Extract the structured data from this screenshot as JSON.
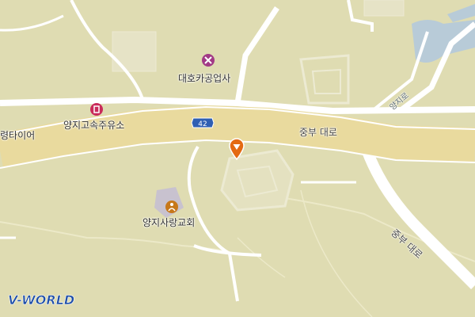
{
  "map": {
    "background_color": "#dfdcb2",
    "road_color": "#ffffff",
    "major_road_color": "#e9da9e",
    "water_color": "#b8cbd8"
  },
  "labels": {
    "repair_shop": "대호카공업사",
    "gas_station": "양지고속주유소",
    "church": "양지사랑교회",
    "tire_shop_partial": "령타이어",
    "jungbu_road_main": "중부 대로",
    "jungbu_road_diag": "중부 대로",
    "yangji_ro": "양지로",
    "route_shield": "42"
  },
  "icons": {
    "repair_shop": "wrench-icon",
    "gas_station": "gas-pump-icon",
    "church": "church-icon",
    "marker": "location-pin-icon"
  },
  "branding": {
    "logo_text": "V-WORLD"
  }
}
